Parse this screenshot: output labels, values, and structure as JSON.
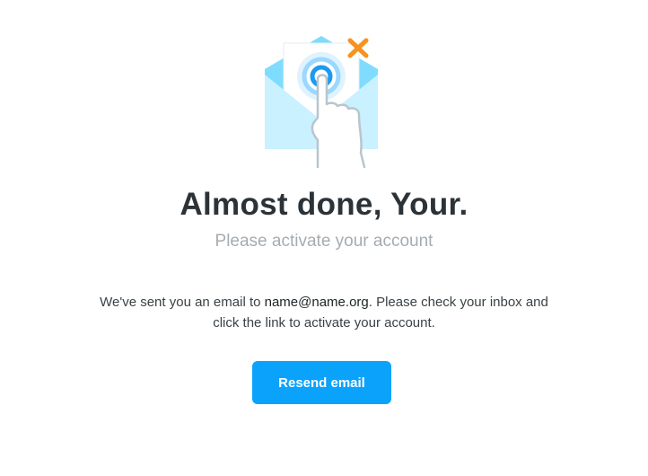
{
  "illustration": {
    "name": "envelope-touch-illustration",
    "colors": {
      "envelope_back": "#7fdcff",
      "envelope_front": "#c9f1ff",
      "letter": "#ffffff",
      "target_ring_outer": "#dff3ff",
      "target_ring_mid": "#9bd8ff",
      "target_center": "#1a9bf0",
      "sparkle": "#f7931e",
      "hand_outline": "#b9c5cc"
    }
  },
  "heading": {
    "title": "Almost done, Your.",
    "subtitle": "Please activate your account"
  },
  "message": {
    "before_email": "We've sent you an email to ",
    "email": "name@name.org",
    "after_email": ". Please check your inbox and click the link to activate your account."
  },
  "actions": {
    "resend_label": "Resend email",
    "accent_color": "#0aa2fb"
  }
}
